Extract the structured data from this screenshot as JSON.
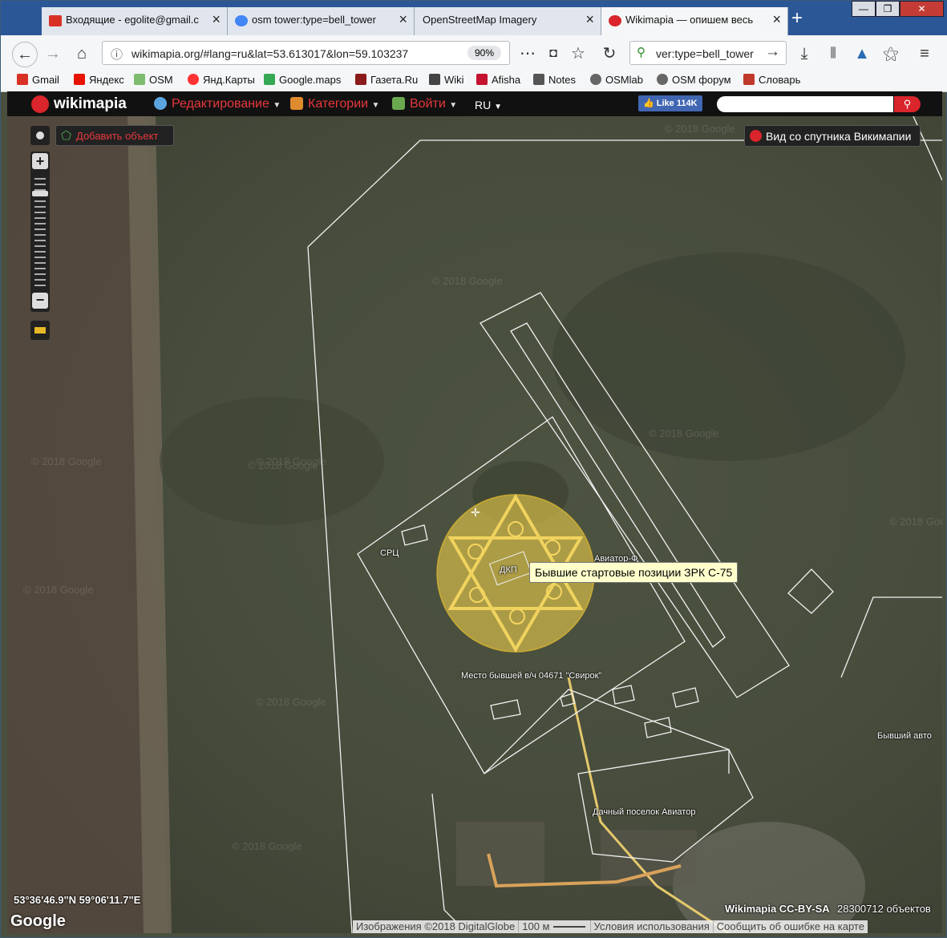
{
  "browser": {
    "tabs": [
      {
        "label": "Входящие - egolite@gmail.c",
        "favicon_color": "#d93025"
      },
      {
        "label": "osm tower:type=bell_tower",
        "favicon_color": "#4285f4"
      },
      {
        "label": "OpenStreetMap Imagery",
        "favicon_color": "#9aa0a6"
      },
      {
        "label": "Wikimapia — опишем весь",
        "favicon_color": "#d9252b"
      }
    ],
    "url": "wikimapia.org/#lang=ru&lat=53.613017&lon=59.103237",
    "zoom": "90%",
    "search_value": "ver:type=bell_tower",
    "bookmarks": [
      {
        "label": "Gmail",
        "color": "#d93025"
      },
      {
        "label": "Яндекс",
        "color": "#e61400"
      },
      {
        "label": "OSM",
        "color": "#7ebc6f"
      },
      {
        "label": "Янд.Карты",
        "color": "#ff3333"
      },
      {
        "label": "Google.maps",
        "color": "#34a853"
      },
      {
        "label": "Газета.Ru",
        "color": "#8b1a1a"
      },
      {
        "label": "Wiki",
        "color": "#444444"
      },
      {
        "label": "Afisha",
        "color": "#c4122f"
      },
      {
        "label": "Notes",
        "color": "#555555"
      },
      {
        "label": "OSMlab",
        "color": "#666666"
      },
      {
        "label": "OSM форум",
        "color": "#666666"
      },
      {
        "label": "Словарь",
        "color": "#c0392b"
      }
    ]
  },
  "wikimapia": {
    "logo": "wikimapia",
    "menu": {
      "edit": "Редактирование",
      "categories": "Категории",
      "login": "Войти",
      "lang": "RU"
    },
    "fb_like": "Like 114K",
    "add_object": "Добавить объект",
    "satellite_view": "Вид со спутника Викимапии"
  },
  "map": {
    "tooltip": "Бывшие стартовые позиции ЗРК С-75",
    "labels": {
      "src": "СРЦ",
      "dkp": "ДКП",
      "aviator_partial": "Авиатор-Ф",
      "military_unit": "Место бывшей в/ч 04671 \"Свирок\"",
      "dacha": "Дачный поселок  Авиатор",
      "former_auto": "Бывший авто"
    },
    "coordinates": "53°36'46.9\"N 59°06'11.7\"E",
    "google_logo": "Google",
    "license": "Wikimapia CC-BY-SA",
    "object_count": "28300712 объектов",
    "footer": {
      "imagery": "Изображения ©2018 DigitalGlobe",
      "scale": "100 м",
      "terms": "Условия использования",
      "report": "Сообщить об ошибке на карте"
    },
    "watermark": "© 2018 Google"
  },
  "colors": {
    "accent": "#e8383d",
    "highlight": "#e8c94a",
    "road": "#e5c96b"
  }
}
